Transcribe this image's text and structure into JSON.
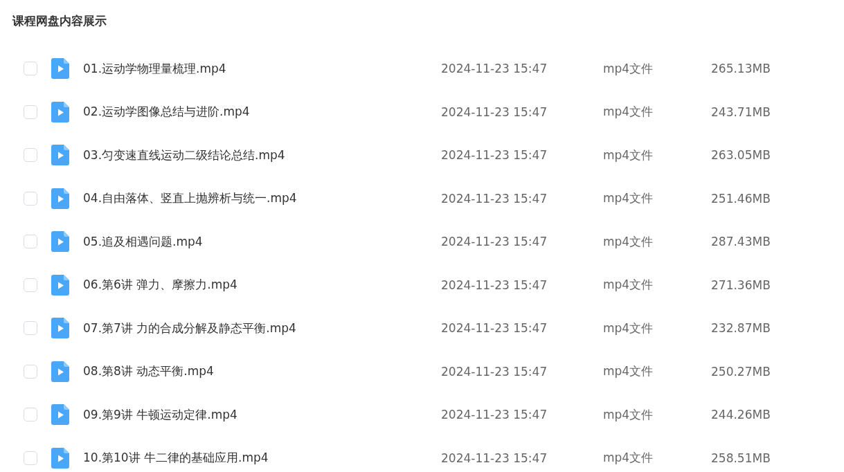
{
  "title": "课程网盘内容展示",
  "files": [
    {
      "name": "01.运动学物理量梳理.mp4",
      "date": "2024-11-23 15:47",
      "type": "mp4文件",
      "size": "265.13MB",
      "checked": false
    },
    {
      "name": "02.运动学图像总结与进阶.mp4",
      "date": "2024-11-23 15:47",
      "type": "mp4文件",
      "size": "243.71MB",
      "checked": false
    },
    {
      "name": "03.匀变速直线运动二级结论总结.mp4",
      "date": "2024-11-23 15:47",
      "type": "mp4文件",
      "size": "263.05MB",
      "checked": false
    },
    {
      "name": "04.自由落体、竖直上抛辨析与统一.mp4",
      "date": "2024-11-23 15:47",
      "type": "mp4文件",
      "size": "251.46MB",
      "checked": false
    },
    {
      "name": "05.追及相遇问题.mp4",
      "date": "2024-11-23 15:47",
      "type": "mp4文件",
      "size": "287.43MB",
      "checked": false
    },
    {
      "name": "06.第6讲 弹力、摩擦力.mp4",
      "date": "2024-11-23 15:47",
      "type": "mp4文件",
      "size": "271.36MB",
      "checked": false
    },
    {
      "name": "07.第7讲 力的合成分解及静态平衡.mp4",
      "date": "2024-11-23 15:47",
      "type": "mp4文件",
      "size": "232.87MB",
      "checked": false
    },
    {
      "name": "08.第8讲 动态平衡.mp4",
      "date": "2024-11-23 15:47",
      "type": "mp4文件",
      "size": "250.27MB",
      "checked": false
    },
    {
      "name": "09.第9讲 牛顿运动定律.mp4",
      "date": "2024-11-23 15:47",
      "type": "mp4文件",
      "size": "244.26MB",
      "checked": false
    },
    {
      "name": "10.第10讲 牛二律的基础应用.mp4",
      "date": "2024-11-23 15:47",
      "type": "mp4文件",
      "size": "258.51MB",
      "checked": false
    }
  ]
}
